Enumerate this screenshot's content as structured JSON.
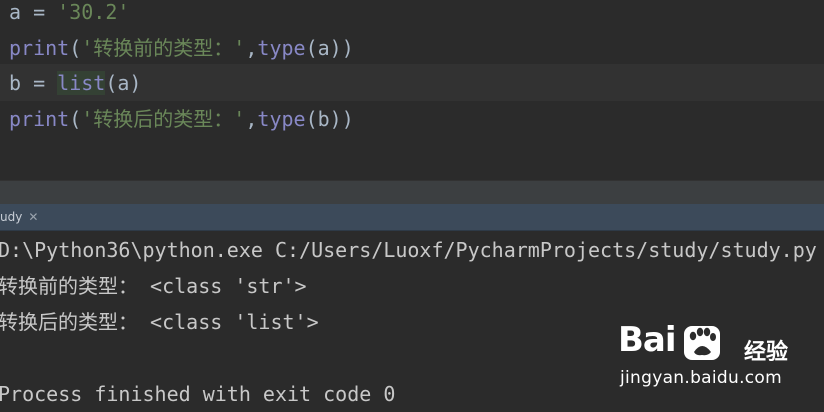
{
  "editor": {
    "line1": {
      "var": "a",
      "op": " = ",
      "value": "'30.2'"
    },
    "line2": {
      "func": "print",
      "open": "(",
      "str": "'转换前的类型：'",
      "comma": ",",
      "type_func": "type",
      "arg": "(a))"
    },
    "line3": {
      "var": "b",
      "op": " = ",
      "func": "list",
      "arg": "(a)"
    },
    "line4": {
      "func": "print",
      "open": "(",
      "str": "'转换后的类型：'",
      "comma": ",",
      "type_func": "type",
      "arg": "(b))"
    }
  },
  "run_tab": {
    "label": "udy",
    "close_icon": "close-icon"
  },
  "console": {
    "command": "D:\\Python36\\python.exe C:/Users/Luoxf/PycharmProjects/study/study.py",
    "output1": "转换前的类型： <class 'str'>",
    "output2": "转换后的类型： <class 'list'>",
    "exit_message": "Process finished with exit code 0"
  },
  "watermark": {
    "brand": "Bai",
    "brand_tail": "du",
    "product": "经验",
    "url": "jingyan.baidu.com"
  },
  "colors": {
    "editor_bg": "#2b2b2b",
    "keyword": "#8888c6",
    "string": "#6a8759",
    "identifier": "#a9b7c6",
    "console_text": "#c8c8c8",
    "tab_bar": "#3c4a5a"
  }
}
